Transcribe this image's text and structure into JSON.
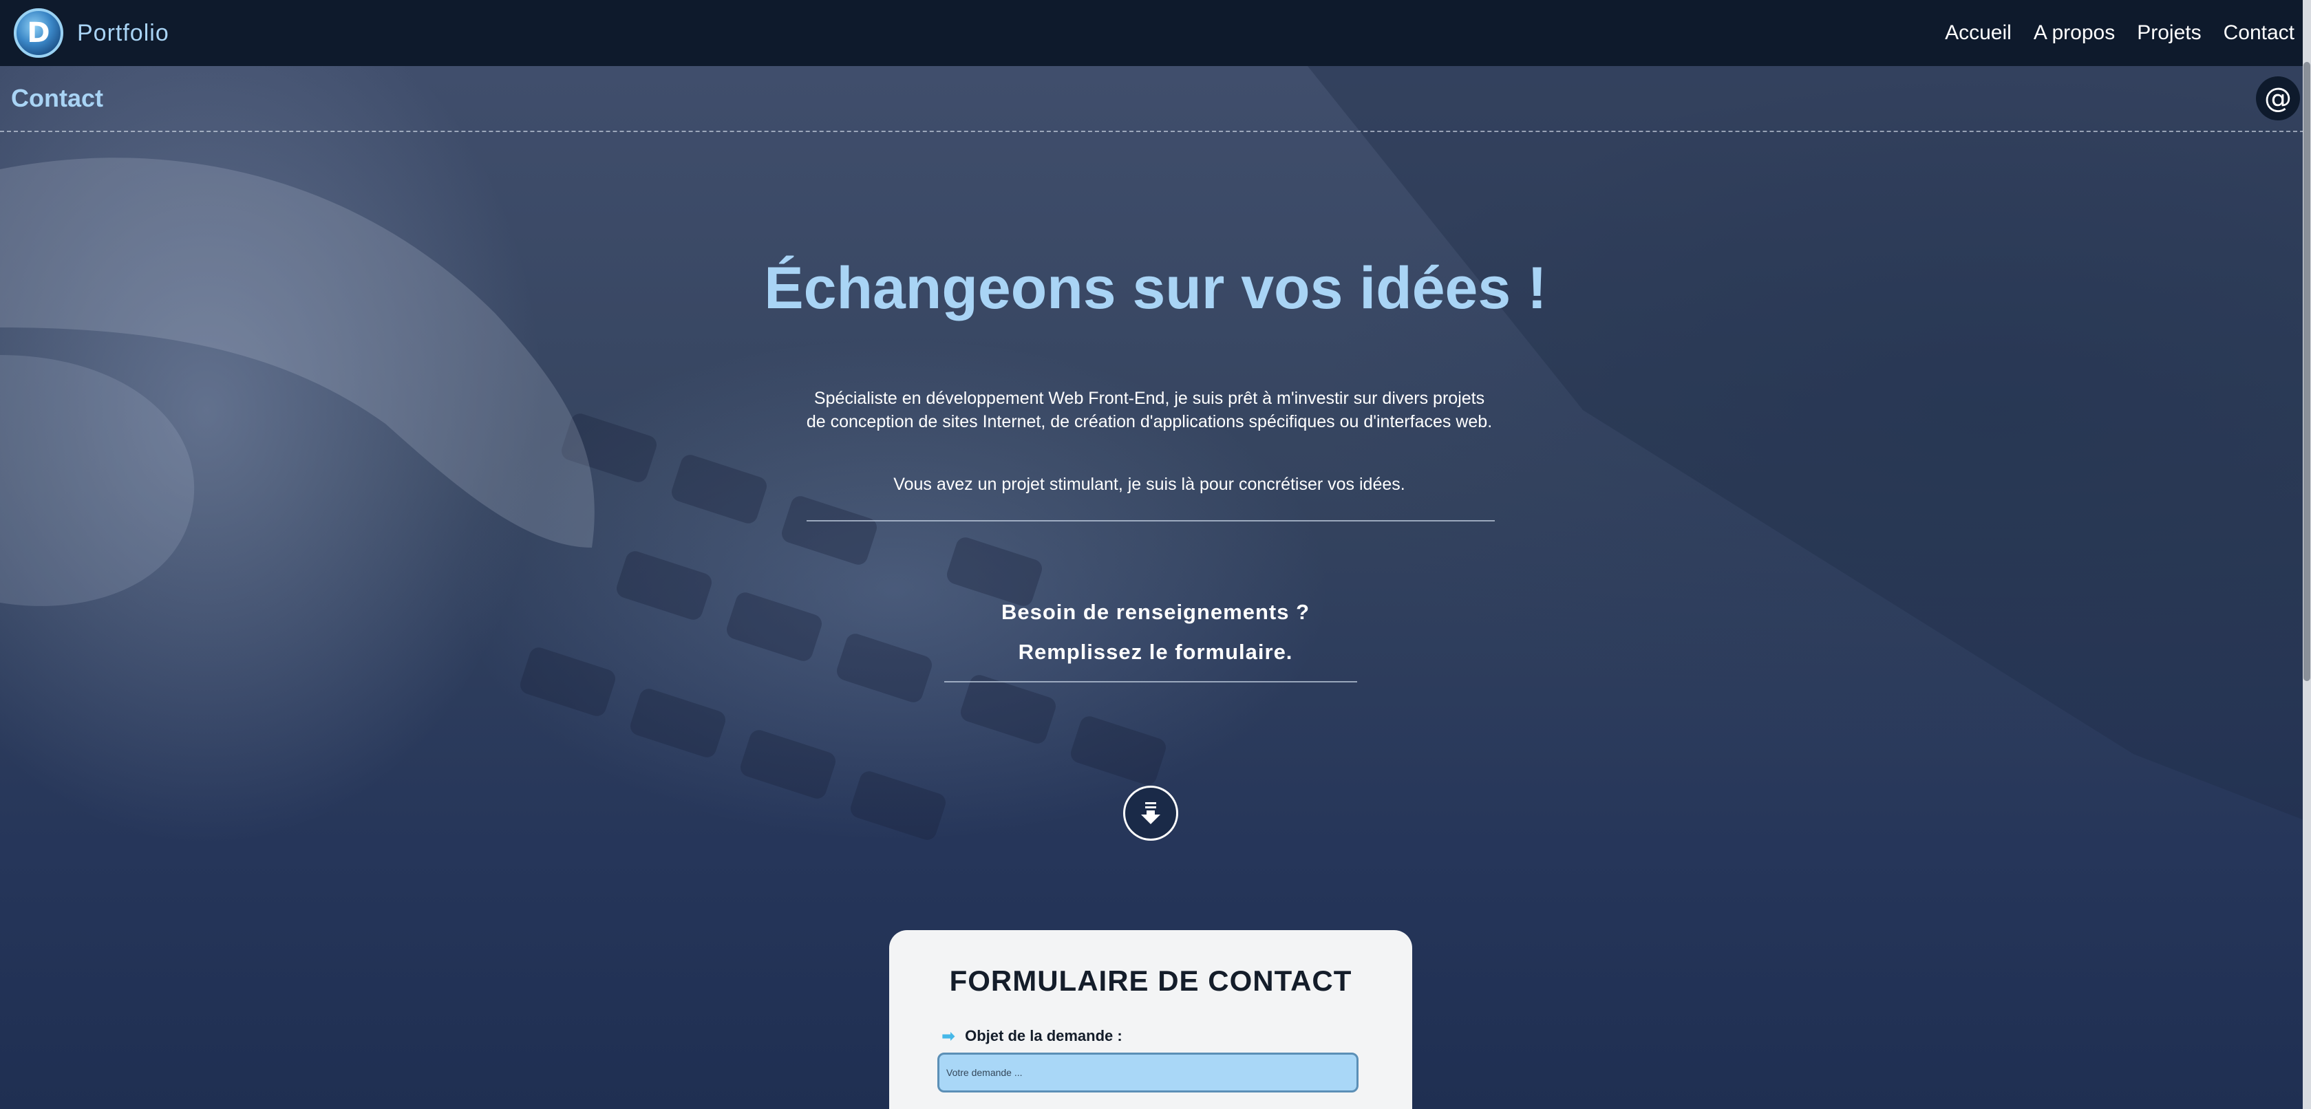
{
  "navbar": {
    "logo_letter": "D",
    "brand": "Portfolio",
    "links": [
      "Accueil",
      "A propos",
      "Projets",
      "Contact"
    ]
  },
  "page": {
    "title": "Contact",
    "at_icon": "@"
  },
  "hero": {
    "title": "Échangeons sur vos idées !",
    "intro": "Spécialiste en développement Web Front-End, je suis prêt à m'investir sur divers projets de conception de sites Internet, de création d'applications spécifiques ou d'interfaces web.",
    "intro2": "Vous avez un projet stimulant, je suis là pour concrétiser vos idées.",
    "cta_line1": "Besoin de renseignements ?",
    "cta_line2": "Remplissez le formulaire."
  },
  "form": {
    "title": "FORMULAIRE DE CONTACT",
    "subject_label": "Objet de la demande :",
    "subject_placeholder": "Votre demande ...",
    "subject_value": ""
  },
  "colors": {
    "accent": "#a9d4f5",
    "navbar_bg": "#0e1a2c",
    "input_bg": "#a9d7f7"
  }
}
